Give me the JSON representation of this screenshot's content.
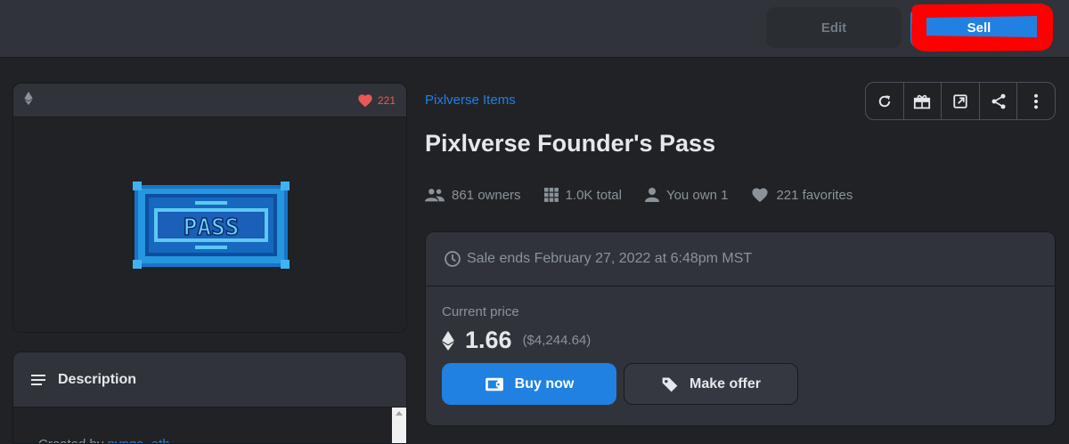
{
  "topbar": {
    "edit_label": "Edit",
    "sell_label": "Sell",
    "annotation_color": "#ff0000"
  },
  "asset": {
    "chain_icon": "ethereum-icon",
    "favorite_icon": "heart-icon",
    "favorite_count": "221",
    "image_text": "PASS"
  },
  "description": {
    "heading": "Description",
    "created_by_label": "Created by",
    "creator": "pvpgo_eth"
  },
  "collection": {
    "name": "Pixlverse Items"
  },
  "title": "Pixlverse Founder's Pass",
  "toolbar": {
    "icons": [
      "refresh-icon",
      "gift-icon",
      "external-link-icon",
      "share-icon",
      "more-icon"
    ]
  },
  "stats": {
    "owners": "861 owners",
    "total": "1.0K total",
    "you_own": "You own 1",
    "favorites": "221 favorites"
  },
  "sale": {
    "ends": "Sale ends February 27, 2022 at 6:48pm MST",
    "current_price_label": "Current price",
    "price": "1.66",
    "usd": "($4,244.64)",
    "buy_label": "Buy now",
    "offer_label": "Make offer"
  },
  "colors": {
    "accent": "#2081e2",
    "heart": "#eb5757",
    "background": "#202225"
  }
}
